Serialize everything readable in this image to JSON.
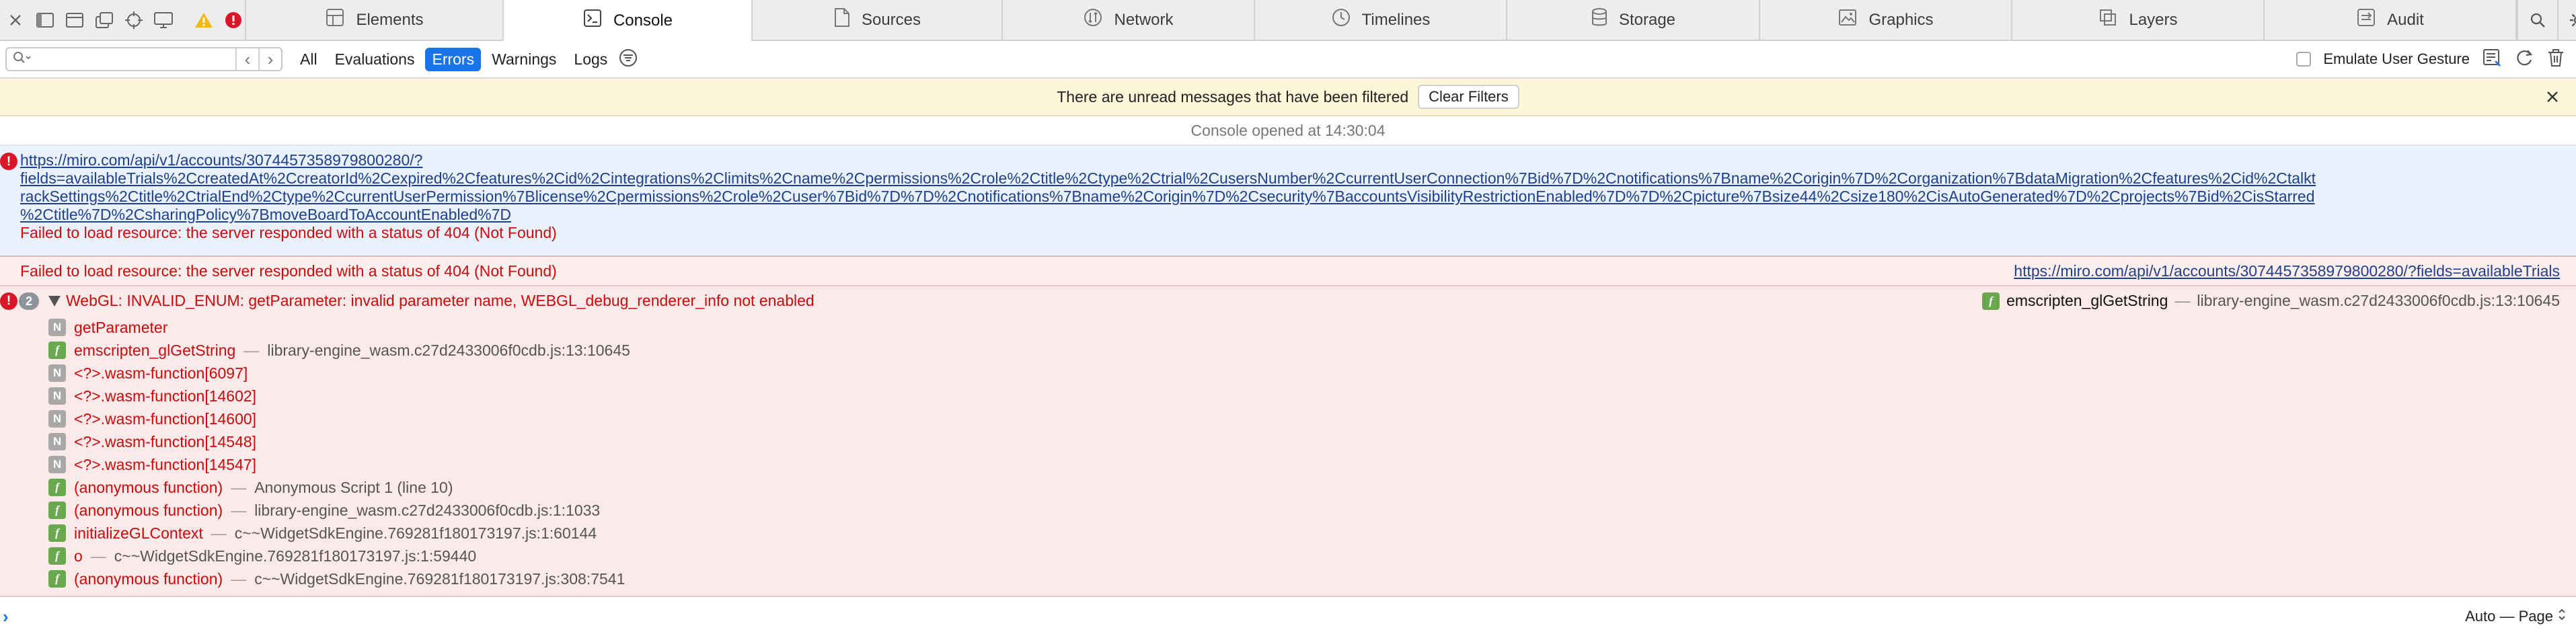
{
  "tabs": [
    {
      "label": "Elements",
      "icon": "elements-icon"
    },
    {
      "label": "Console",
      "icon": "console-icon"
    },
    {
      "label": "Sources",
      "icon": "sources-icon"
    },
    {
      "label": "Network",
      "icon": "network-icon"
    },
    {
      "label": "Timelines",
      "icon": "timelines-icon"
    },
    {
      "label": "Storage",
      "icon": "storage-icon"
    },
    {
      "label": "Graphics",
      "icon": "graphics-icon"
    },
    {
      "label": "Layers",
      "icon": "layers-icon"
    },
    {
      "label": "Audit",
      "icon": "audit-icon"
    }
  ],
  "active_tab": "Console",
  "filter": {
    "search_value": "",
    "levels": [
      "All",
      "Evaluations",
      "Errors",
      "Warnings",
      "Logs"
    ],
    "selected_level": "Errors",
    "emulate_label": "Emulate User Gesture"
  },
  "banner": {
    "text": "There are unread messages that have been filtered",
    "clear_label": "Clear Filters"
  },
  "console": {
    "opened_text": "Console opened at 14:30:04",
    "messages": [
      {
        "url": "https://miro.com/api/v1/accounts/3074457358979800280/?fields=availableTrials%2CcreatedAt%2CcreatorId%2Cexpired%2Cfeatures%2Cid%2Cintegrations%2Climits%2Cname%2Cpermissions%2Crole%2Ctitle%2Ctype%2Ctrial%2CusersNumber%2CcurrentUserConnection%7Bid%7D%2Cnotifications%7Bname%2Corigin%7D%2Corganization%7BdataMigration%2Cfeatures%2Cid%2CtalktrackSettings%2Ctitle%2CtrialEnd%2Ctype%2CcurrentUserPermission%7Blicense%2Cpermissions%2Crole%2Cuser%7Bid%7D%7D%2Cnotifications%7Bname%2Corigin%7D%2Csecurity%7BaccountsVisibilityRestrictionEnabled%7D%7D%2Cpicture%7Bsize44%2Csize180%2CisAutoGenerated%7D%2Cprojects%7Bid%2CisStarred%2Ctitle%7D%2CsharingPolicy%7BmoveBoardToAccountEnabled%7D",
        "url_lines": [
          "https://miro.com/api/v1/accounts/3074457358979800280/?",
          "fields=availableTrials%2CcreatedAt%2CcreatorId%2Cexpired%2Cfeatures%2Cid%2Cintegrations%2Climits%2Cname%2Cpermissions%2Crole%2Ctitle%2Ctype%2Ctrial%2CusersNumber%2CcurrentUserConnection%7Bid%7D%2Cnotifications%7Bname%2Corigin%7D%2Corganization%7BdataMigration%2Cfeatures%2Cid%2Ctalkt",
          "rackSettings%2Ctitle%2CtrialEnd%2Ctype%2CcurrentUserPermission%7Blicense%2Cpermissions%2Crole%2Cuser%7Bid%7D%7D%2Cnotifications%7Bname%2Corigin%7D%2Csecurity%7BaccountsVisibilityRestrictionEnabled%7D%7D%2Cpicture%7Bsize44%2Csize180%2CisAutoGenerated%7D%2Cprojects%7Bid%2CisStarred",
          "%2Ctitle%7D%2CsharingPolicy%7BmoveBoardToAccountEnabled%7D"
        ],
        "text": "Failed to load resource: the server responded with a status of 404 (Not Found)"
      },
      {
        "text": "Failed to load resource: the server responded with a status of 404 (Not Found)",
        "source": "https://miro.com/api/v1/accounts/3074457358979800280/?fields=availableTrials"
      },
      {
        "count": "2",
        "text": "WebGL: INVALID_ENUM: getParameter: invalid parameter name, WEBGL_debug_renderer_info not enabled",
        "source_fn": "emscripten_glGetString",
        "source_loc": "library-engine_wasm.c27d2433006f0cdb.js:13:10645",
        "frames": [
          {
            "kind": "N",
            "name": "getParameter",
            "loc": ""
          },
          {
            "kind": "f",
            "name": "emscripten_glGetString",
            "loc": "library-engine_wasm.c27d2433006f0cdb.js:13:10645"
          },
          {
            "kind": "N",
            "name": "<?>.wasm-function[6097]",
            "loc": ""
          },
          {
            "kind": "N",
            "name": "<?>.wasm-function[14602]",
            "loc": ""
          },
          {
            "kind": "N",
            "name": "<?>.wasm-function[14600]",
            "loc": ""
          },
          {
            "kind": "N",
            "name": "<?>.wasm-function[14548]",
            "loc": ""
          },
          {
            "kind": "N",
            "name": "<?>.wasm-function[14547]",
            "loc": ""
          },
          {
            "kind": "f",
            "name": "(anonymous function)",
            "loc": "Anonymous Script 1 (line 10)"
          },
          {
            "kind": "f",
            "name": "(anonymous function)",
            "loc": "library-engine_wasm.c27d2433006f0cdb.js:1:1033"
          },
          {
            "kind": "f",
            "name": "initializeGLContext",
            "loc": "c~~WidgetSdkEngine.769281f180173197.js:1:60144"
          },
          {
            "kind": "f",
            "name": "o",
            "loc": "c~~WidgetSdkEngine.769281f180173197.js:1:59440"
          },
          {
            "kind": "f",
            "name": "(anonymous function)",
            "loc": "c~~WidgetSdkEngine.769281f180173197.js:308:7541"
          }
        ]
      }
    ],
    "separator": "—"
  },
  "prompt": {
    "mode_label": "Auto — Page"
  },
  "colors": {
    "accent": "#1a73e8",
    "error_text": "#cc0a0a",
    "error_bg": "#fce9e9",
    "info_bg": "#e9f2fc",
    "banner_bg": "#fdf6d8"
  }
}
